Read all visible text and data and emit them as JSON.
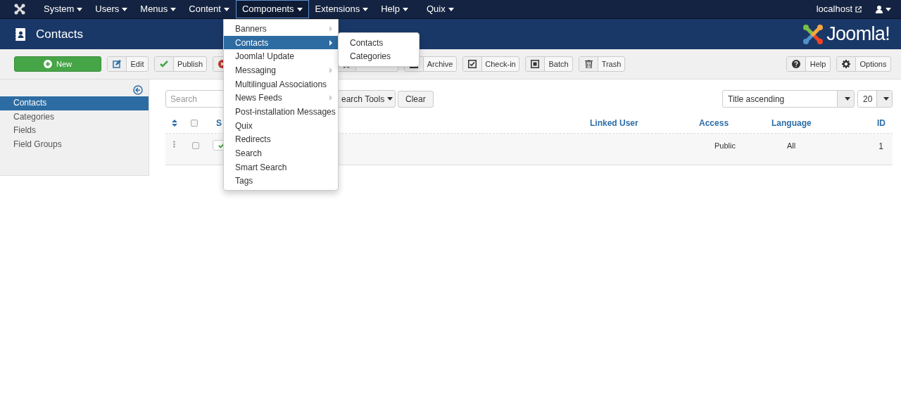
{
  "navbar": {
    "menus": [
      {
        "label": "System",
        "selected": false
      },
      {
        "label": "Users",
        "selected": false
      },
      {
        "label": "Menus",
        "selected": false
      },
      {
        "label": "Content",
        "selected": false
      },
      {
        "label": "Components",
        "selected": true
      },
      {
        "label": "Extensions",
        "selected": false
      },
      {
        "label": "Help",
        "selected": false
      },
      {
        "label": "Quix",
        "selected": false
      }
    ],
    "site": "localhost"
  },
  "header": {
    "title": "Contacts",
    "brand": "Joomla!"
  },
  "toolbar": {
    "buttons": [
      {
        "kind": "new",
        "label": "New"
      },
      {
        "kind": "edit",
        "label": "Edit"
      },
      {
        "kind": "publish",
        "label": "Publish"
      },
      {
        "kind": "unpublish"
      },
      {
        "kind": "unfeature"
      },
      {
        "kind": "archive",
        "label": "Archive"
      },
      {
        "kind": "checkin",
        "label": "Check-in"
      },
      {
        "kind": "batch",
        "label": "Batch"
      },
      {
        "kind": "trash",
        "label": "Trash"
      }
    ],
    "right": [
      {
        "kind": "help",
        "label": "Help"
      },
      {
        "kind": "options",
        "label": "Options"
      }
    ]
  },
  "sidebar": {
    "items": [
      {
        "label": "Contacts",
        "selected": true
      },
      {
        "label": "Categories",
        "selected": false
      },
      {
        "label": "Fields",
        "selected": false
      },
      {
        "label": "Field Groups",
        "selected": false
      }
    ]
  },
  "filters": {
    "search": {
      "placeholder": "Search"
    },
    "tools": "earch Tools",
    "clear": "Clear",
    "ordering": "Title ascending",
    "limit": "20"
  },
  "table": {
    "select_all_checked": false,
    "columns": [
      "S",
      "Linked User",
      "Access",
      "Language",
      "ID"
    ],
    "rows": [
      {
        "checked": false,
        "published": true,
        "access": "Public",
        "language": "All",
        "id": "1"
      }
    ]
  },
  "menu": {
    "items": [
      {
        "label": "Banners",
        "has_submenu": true,
        "selected": false
      },
      {
        "label": "Contacts",
        "has_submenu": true,
        "selected": true
      },
      {
        "label": "Joomla! Update",
        "has_submenu": false,
        "selected": false
      },
      {
        "label": "Messaging",
        "has_submenu": true,
        "selected": false
      },
      {
        "label": "Multilingual Associations",
        "has_submenu": false,
        "selected": false
      },
      {
        "label": "News Feeds",
        "has_submenu": true,
        "selected": false
      },
      {
        "label": "Post-installation Messages",
        "has_submenu": false,
        "selected": false
      },
      {
        "label": "Quix",
        "has_submenu": false,
        "selected": false
      },
      {
        "label": "Redirects",
        "has_submenu": false,
        "selected": false
      },
      {
        "label": "Search",
        "has_submenu": false,
        "selected": false
      },
      {
        "label": "Smart Search",
        "has_submenu": false,
        "selected": false
      },
      {
        "label": "Tags",
        "has_submenu": false,
        "selected": false
      }
    ],
    "submenu": [
      {
        "label": "Contacts"
      },
      {
        "label": "Categories"
      }
    ]
  }
}
